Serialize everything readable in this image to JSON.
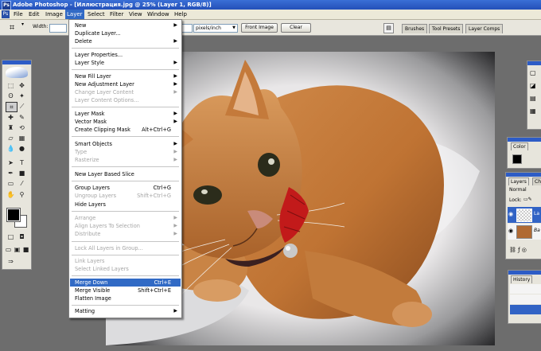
{
  "window": {
    "title": "Adobe Photoshop - [Иллюстрация.jpg @ 25% (Layer 1, RGB/8)]",
    "icon": "Ps"
  },
  "menubar": [
    "File",
    "Edit",
    "Image",
    "Layer",
    "Select",
    "Filter",
    "View",
    "Window",
    "Help"
  ],
  "active_menu": "Layer",
  "options_bar": {
    "width_label": "Width:",
    "resolution_unit": "pixels/inch",
    "front_image_button": "Front Image",
    "clear_button": "Clear"
  },
  "palette_well": [
    "Brushes",
    "Tool Presets",
    "Layer Comps"
  ],
  "layer_menu": [
    {
      "label": "New",
      "arrow": true
    },
    {
      "label": "Duplicate Layer..."
    },
    {
      "label": "Delete",
      "arrow": true
    },
    {
      "label": "Layer Properties..."
    },
    {
      "label": "Layer Style",
      "arrow": true
    },
    {
      "label": "New Fill Layer",
      "arrow": true
    },
    {
      "label": "New Adjustment Layer",
      "arrow": true
    },
    {
      "label": "Change Layer Content",
      "arrow": true,
      "disabled": true
    },
    {
      "label": "Layer Content Options...",
      "disabled": true
    },
    {
      "label": "Layer Mask",
      "arrow": true
    },
    {
      "label": "Vector Mask",
      "arrow": true
    },
    {
      "label": "Create Clipping Mask",
      "shortcut": "Alt+Ctrl+G"
    },
    {
      "label": "Smart Objects",
      "arrow": true
    },
    {
      "label": "Type",
      "arrow": true,
      "disabled": true
    },
    {
      "label": "Rasterize",
      "arrow": true,
      "disabled": true
    },
    {
      "label": "New Layer Based Slice"
    },
    {
      "label": "Group Layers",
      "shortcut": "Ctrl+G"
    },
    {
      "label": "Ungroup Layers",
      "shortcut": "Shift+Ctrl+G",
      "disabled": true
    },
    {
      "label": "Hide Layers"
    },
    {
      "label": "Arrange",
      "arrow": true,
      "disabled": true
    },
    {
      "label": "Align Layers To Selection",
      "arrow": true,
      "disabled": true
    },
    {
      "label": "Distribute",
      "arrow": true,
      "disabled": true
    },
    {
      "label": "Lock All Layers in Group...",
      "disabled": true
    },
    {
      "label": "Link Layers",
      "disabled": true
    },
    {
      "label": "Select Linked Layers",
      "disabled": true
    },
    {
      "label": "Merge Down",
      "shortcut": "Ctrl+E",
      "highlighted": true
    },
    {
      "label": "Merge Visible",
      "shortcut": "Shift+Ctrl+E"
    },
    {
      "label": "Flatten Image"
    },
    {
      "label": "Matting",
      "arrow": true
    }
  ],
  "panels": {
    "color_tab": "Color",
    "layers_tab": "Layers",
    "channels_tab_partial": "Cha",
    "blend_mode": "Normal",
    "lock_label": "Lock:",
    "history_tab": "History"
  },
  "colors": {
    "menu_highlight": "#316ac5",
    "title_bar": "#2350b8",
    "workspace": "#6d6d6d"
  }
}
